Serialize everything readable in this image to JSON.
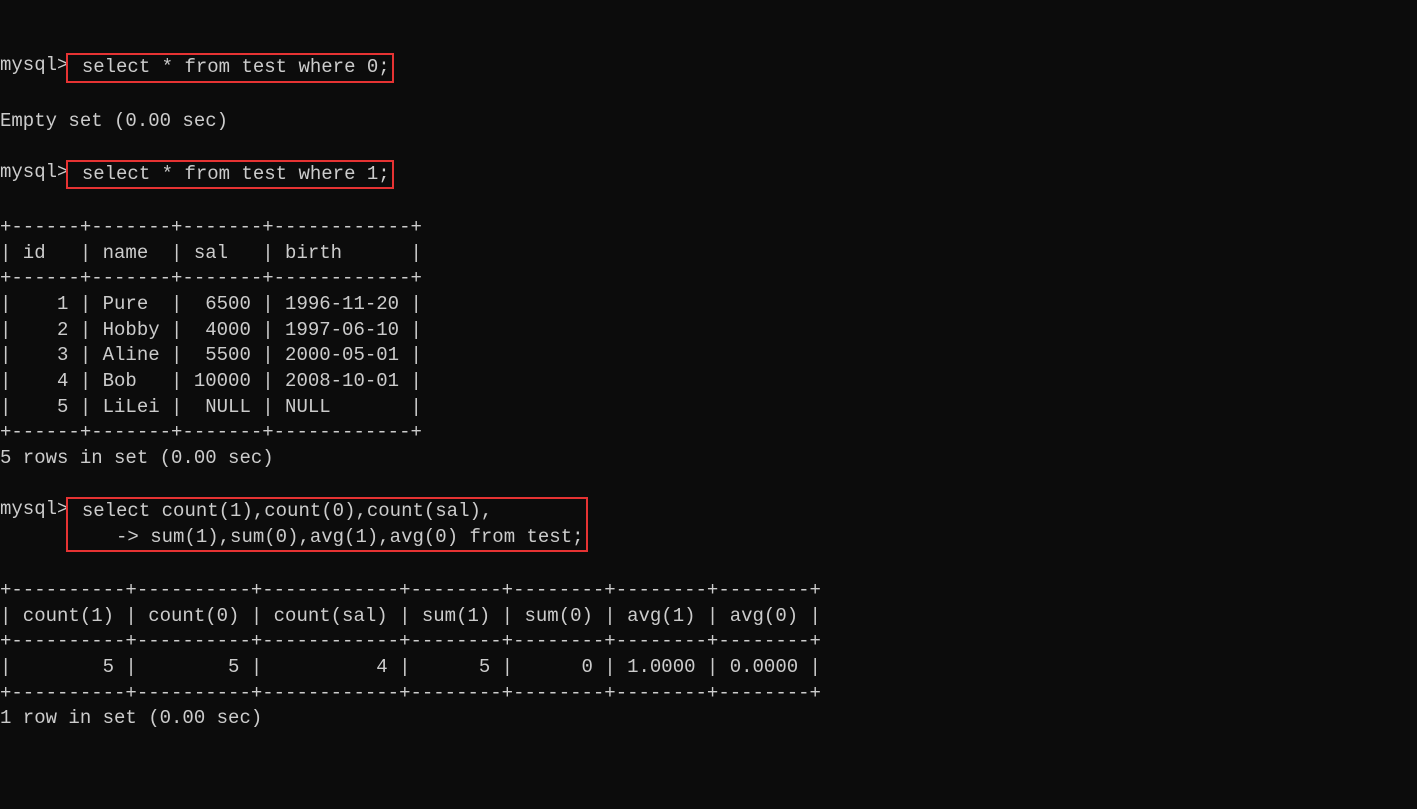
{
  "prompt": "mysql>",
  "cont_prompt": "    ->",
  "query1": {
    "sql": " select * from test where 0;",
    "result": "Empty set (0.00 sec)"
  },
  "query2": {
    "sql": " select * from test where 1;",
    "table_border_top": "+------+-------+-------+------------+",
    "table_header": "| id   | name  | sal   | birth      |",
    "table_border_mid": "+------+-------+-------+------------+",
    "rows": [
      "|    1 | Pure  |  6500 | 1996-11-20 |",
      "|    2 | Hobby |  4000 | 1997-06-10 |",
      "|    3 | Aline |  5500 | 2000-05-01 |",
      "|    4 | Bob   | 10000 | 2008-10-01 |",
      "|    5 | LiLei |  NULL | NULL       |"
    ],
    "table_border_bot": "+------+-------+-------+------------+",
    "result": "5 rows in set (0.00 sec)"
  },
  "query3": {
    "sql_line1": " select count(1),count(0),count(sal),",
    "sql_line2": " sum(1),sum(0),avg(1),avg(0) from test;",
    "table_border_top": "+----------+----------+------------+--------+--------+--------+--------+",
    "table_header": "| count(1) | count(0) | count(sal) | sum(1) | sum(0) | avg(1) | avg(0) |",
    "table_border_mid": "+----------+----------+------------+--------+--------+--------+--------+",
    "row": "|        5 |        5 |          4 |      5 |      0 | 1.0000 | 0.0000 |",
    "table_border_bot": "+----------+----------+------------+--------+--------+--------+--------+",
    "result": "1 row in set (0.00 sec)"
  },
  "chart_data": {
    "type": "table",
    "tables": [
      {
        "columns": [
          "id",
          "name",
          "sal",
          "birth"
        ],
        "rows": [
          [
            1,
            "Pure",
            6500,
            "1996-11-20"
          ],
          [
            2,
            "Hobby",
            4000,
            "1997-06-10"
          ],
          [
            3,
            "Aline",
            5500,
            "2000-05-01"
          ],
          [
            4,
            "Bob",
            10000,
            "2008-10-01"
          ],
          [
            5,
            "LiLei",
            null,
            null
          ]
        ]
      },
      {
        "columns": [
          "count(1)",
          "count(0)",
          "count(sal)",
          "sum(1)",
          "sum(0)",
          "avg(1)",
          "avg(0)"
        ],
        "rows": [
          [
            5,
            5,
            4,
            5,
            0,
            1.0,
            0.0
          ]
        ]
      }
    ]
  }
}
